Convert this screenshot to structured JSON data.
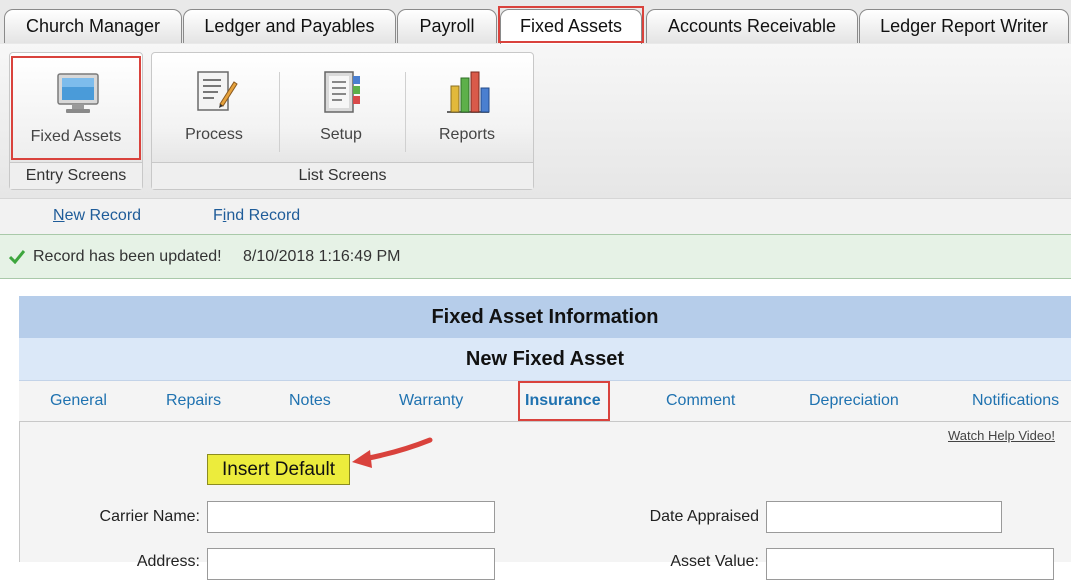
{
  "tabs": [
    {
      "label": "Church Manager"
    },
    {
      "label": "Ledger and Payables"
    },
    {
      "label": "Payroll"
    },
    {
      "label": "Fixed Assets"
    },
    {
      "label": "Accounts Receivable"
    },
    {
      "label": "Ledger Report Writer"
    }
  ],
  "active_tab": "Fixed Assets",
  "ribbon": {
    "entry_group_label": "Entry Screens",
    "list_group_label": "List Screens",
    "buttons": {
      "fixed_assets": {
        "label": "Fixed Assets",
        "icon": "monitor-icon"
      },
      "process": {
        "label": "Process",
        "icon": "document-pencil-icon"
      },
      "setup": {
        "label": "Setup",
        "icon": "notebook-icon"
      },
      "reports": {
        "label": "Reports",
        "icon": "bar-chart-icon"
      }
    }
  },
  "actions": {
    "new_record_underlined": "N",
    "new_record_rest": "ew Record",
    "find_record_pre": "F",
    "find_record_underlined": "i",
    "find_record_rest": "nd Record"
  },
  "status": {
    "message": "Record has been updated!",
    "timestamp": "8/10/2018 1:16:49 PM",
    "icon": "check-icon"
  },
  "form": {
    "title": "Fixed Asset Information",
    "subtitle": "New Fixed Asset",
    "subtabs": [
      {
        "label": "General"
      },
      {
        "label": "Repairs"
      },
      {
        "label": "Notes"
      },
      {
        "label": "Warranty"
      },
      {
        "label": "Insurance"
      },
      {
        "label": "Comment"
      },
      {
        "label": "Depreciation"
      },
      {
        "label": "Notifications"
      }
    ],
    "active_subtab": "Insurance",
    "help_link": "Watch Help Video!",
    "insert_default_label": "Insert Default",
    "fields": {
      "carrier_name": {
        "label": "Carrier Name:",
        "value": ""
      },
      "date_appraised": {
        "label": "Date Appraised",
        "value": ""
      },
      "address": {
        "label": "Address:",
        "value": ""
      },
      "asset_value": {
        "label": "Asset Value:",
        "value": ""
      }
    }
  },
  "colors": {
    "highlight": "#d9423c",
    "header_blue": "#b6cdea",
    "subheader_blue": "#dbe8f8",
    "link_blue": "#1f72b0",
    "insert_yellow": "#ecec3c",
    "status_green": "#e6f2e6"
  }
}
